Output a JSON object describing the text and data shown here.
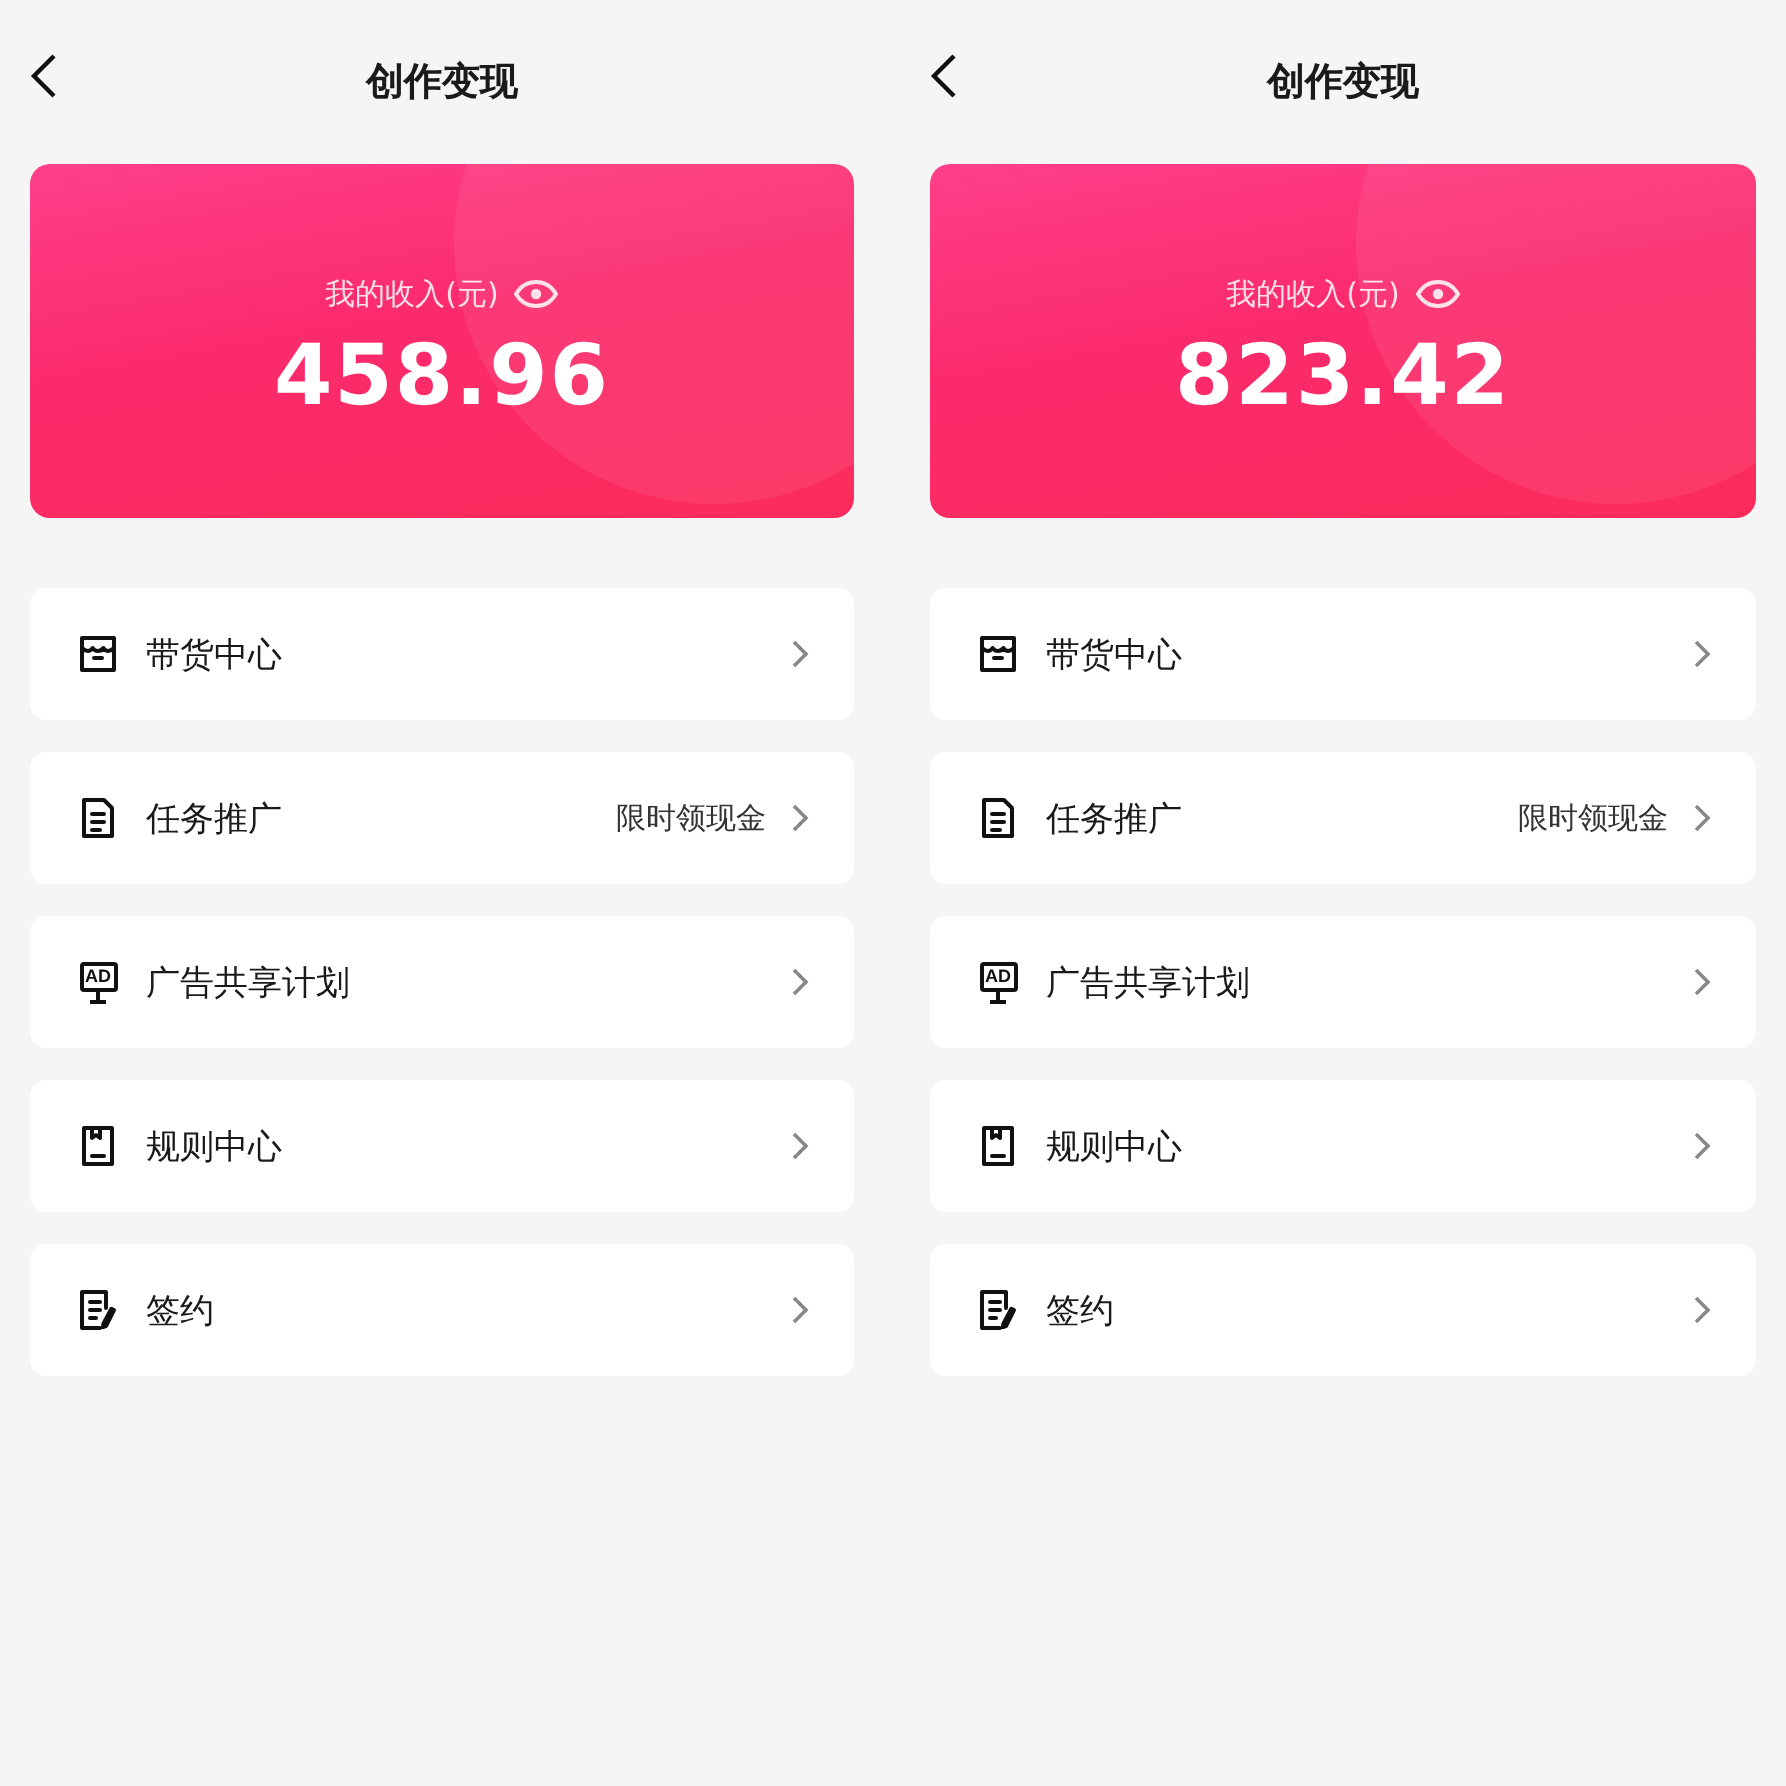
{
  "screens": [
    {
      "title": "创作变现",
      "income": {
        "label": "我的收入(元)",
        "amount": "458.96"
      },
      "menu": [
        {
          "kind": "store",
          "label": "带货中心"
        },
        {
          "kind": "document",
          "label": "任务推广",
          "note": "限时领现金"
        },
        {
          "kind": "ad",
          "label": "广告共享计划",
          "icon_label": "AD"
        },
        {
          "kind": "rules",
          "label": "规则中心"
        },
        {
          "kind": "sign",
          "label": "签约"
        }
      ]
    },
    {
      "title": "创作变现",
      "income": {
        "label": "我的收入(元)",
        "amount": "823.42"
      },
      "menu": [
        {
          "kind": "store",
          "label": "带货中心"
        },
        {
          "kind": "document",
          "label": "任务推广",
          "note": "限时领现金"
        },
        {
          "kind": "ad",
          "label": "广告共享计划",
          "icon_label": "AD"
        },
        {
          "kind": "rules",
          "label": "规则中心"
        },
        {
          "kind": "sign",
          "label": "签约"
        }
      ]
    }
  ]
}
